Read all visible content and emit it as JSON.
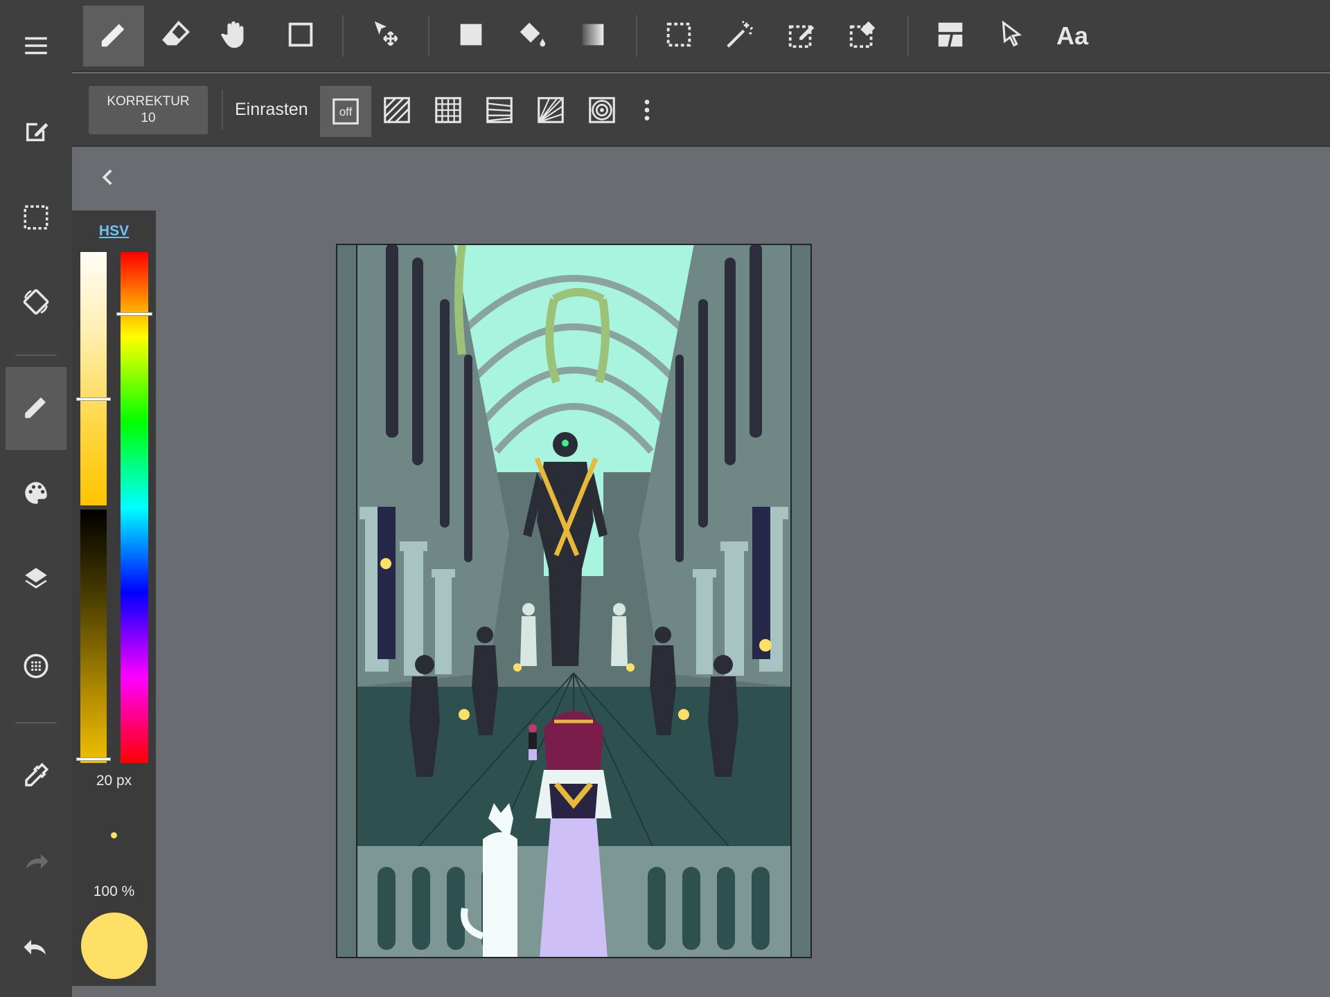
{
  "app": {
    "accent_color": "#6fc3f2",
    "current_color": "#ffe066"
  },
  "left_rail": {
    "items": [
      {
        "id": "menu",
        "icon": "menu-icon"
      },
      {
        "id": "edit",
        "icon": "edit-icon"
      },
      {
        "id": "selection",
        "icon": "selection-icon"
      },
      {
        "id": "rotate",
        "icon": "rotate-screen-icon"
      },
      {
        "id": "brush",
        "icon": "pencil-icon",
        "active": true
      },
      {
        "id": "palette",
        "icon": "palette-icon"
      },
      {
        "id": "layers",
        "icon": "layers-icon"
      },
      {
        "id": "material",
        "icon": "material-icon"
      },
      {
        "id": "eyedropper",
        "icon": "eyedropper-icon"
      },
      {
        "id": "redo",
        "icon": "redo-icon"
      },
      {
        "id": "undo",
        "icon": "undo-icon"
      }
    ]
  },
  "top_toolbar": {
    "tools": [
      {
        "id": "pen",
        "icon": "pencil-icon",
        "active": true
      },
      {
        "id": "eraser",
        "icon": "eraser-icon"
      },
      {
        "id": "hand",
        "icon": "hand-icon"
      },
      {
        "id": "shape",
        "icon": "rectangle-icon"
      },
      {
        "id": "move",
        "icon": "move-icon"
      },
      {
        "id": "fill-rect",
        "icon": "filled-rect-icon"
      },
      {
        "id": "bucket",
        "icon": "paint-bucket-icon"
      },
      {
        "id": "gradient",
        "icon": "gradient-icon"
      },
      {
        "id": "select-rect",
        "icon": "select-rect-icon"
      },
      {
        "id": "magic-wand",
        "icon": "magic-wand-icon"
      },
      {
        "id": "select-pen",
        "icon": "select-pen-icon"
      },
      {
        "id": "select-eraser",
        "icon": "select-eraser-icon"
      },
      {
        "id": "frame",
        "icon": "frame-divider-icon"
      },
      {
        "id": "operation",
        "icon": "pointer-icon"
      }
    ],
    "text_tool_label": "Aa"
  },
  "sub_toolbar": {
    "correction_label": "KORREKTUR",
    "correction_value": "10",
    "snap_label": "Einrasten",
    "snap_off_label": "off",
    "snap_modes": [
      "snap-off-icon",
      "snap-parallel-icon",
      "snap-grid-icon",
      "snap-perspective-icon",
      "snap-radial-icon",
      "snap-circle-icon"
    ],
    "more_icon": "more-vert-icon"
  },
  "color_panel": {
    "mode_label": "HSV",
    "hue_level": 0.12,
    "value_level": 0.58,
    "brush_size": "20 px",
    "opacity": "100 %",
    "color": "#ffe066"
  },
  "canvas": {
    "collapse_icon": "chevron-left-icon"
  }
}
